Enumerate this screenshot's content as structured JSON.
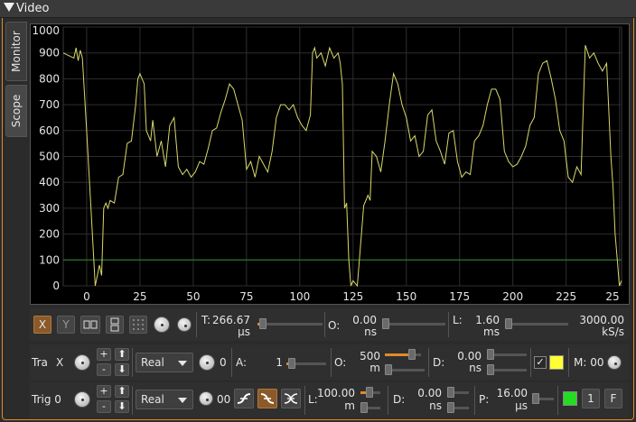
{
  "window": {
    "title": "Video"
  },
  "side_tabs": {
    "monitor": "Monitor",
    "scope": "Scope"
  },
  "chart_data": {
    "type": "line",
    "xlim": [
      -11,
      251
    ],
    "ylim": [
      0,
      1000
    ],
    "x_ticks": [
      "0",
      "25",
      "50",
      "75",
      "100",
      "125",
      "150",
      "175",
      "200",
      "225",
      "25"
    ],
    "y_ticks": [
      "1000",
      "900",
      "800",
      "700",
      "600",
      "500",
      "400",
      "300",
      "200",
      "100",
      "0"
    ],
    "trigger_level": 100,
    "grid": true,
    "series": [
      {
        "color": "#d8d86a",
        "x": [
          -11,
          -6,
          -5,
          -4,
          -3,
          -2,
          0,
          2,
          4,
          6,
          7,
          8,
          9,
          10,
          11,
          13,
          15,
          17,
          19,
          21,
          23,
          24,
          25,
          27,
          28,
          30,
          31,
          33,
          35,
          37,
          39,
          41,
          43,
          45,
          47,
          49,
          51,
          53,
          55,
          57,
          59,
          61,
          63,
          65,
          67,
          69,
          71,
          73,
          75,
          77,
          79,
          81,
          83,
          85,
          87,
          89,
          91,
          93,
          95,
          97,
          99,
          101,
          103,
          105,
          106,
          107,
          108,
          110,
          112,
          114,
          116,
          118,
          119,
          120,
          121,
          122,
          123,
          124,
          125,
          127,
          130,
          132,
          133,
          134,
          136,
          138,
          140,
          142,
          144,
          146,
          148,
          150,
          152,
          154,
          156,
          158,
          160,
          162,
          164,
          166,
          168,
          170,
          172,
          174,
          176,
          178,
          180,
          182,
          184,
          186,
          188,
          190,
          192,
          194,
          196,
          198,
          200,
          202,
          204,
          206,
          208,
          210,
          212,
          214,
          216,
          218,
          220,
          222,
          224,
          226,
          228,
          230,
          232,
          234,
          236,
          238,
          240,
          242,
          244,
          246,
          247,
          248,
          249,
          250,
          251
        ],
        "y": [
          900,
          880,
          920,
          870,
          910,
          880,
          600,
          300,
          0,
          80,
          40,
          300,
          320,
          300,
          330,
          320,
          420,
          430,
          550,
          560,
          700,
          800,
          820,
          780,
          600,
          560,
          640,
          500,
          560,
          460,
          620,
          650,
          460,
          430,
          450,
          420,
          440,
          480,
          470,
          530,
          600,
          610,
          670,
          720,
          780,
          760,
          700,
          640,
          450,
          480,
          420,
          500,
          470,
          440,
          520,
          650,
          700,
          700,
          680,
          700,
          650,
          620,
          600,
          660,
          900,
          920,
          880,
          900,
          850,
          920,
          880,
          900,
          860,
          780,
          300,
          320,
          100,
          0,
          20,
          0,
          310,
          350,
          330,
          520,
          500,
          440,
          560,
          700,
          820,
          780,
          700,
          650,
          560,
          580,
          500,
          520,
          660,
          680,
          560,
          520,
          470,
          590,
          600,
          480,
          420,
          440,
          430,
          560,
          580,
          620,
          700,
          760,
          760,
          720,
          520,
          480,
          460,
          470,
          500,
          540,
          620,
          650,
          820,
          860,
          870,
          800,
          720,
          600,
          560,
          420,
          400,
          460,
          430,
          930,
          880,
          900,
          860,
          830,
          860,
          500,
          380,
          200,
          100,
          0,
          20
        ]
      }
    ]
  },
  "controls": {
    "x_button": "X",
    "y_button": "Y",
    "time_label": "T:",
    "time_value": "266.67",
    "time_unit": "µs",
    "offset_label": "O:",
    "offset_value": "0.00",
    "offset_unit": "ns",
    "length_label": "L:",
    "length_value": "1.60",
    "length_unit": "ms",
    "rate_value": "3000.00",
    "rate_unit": "kS/s"
  },
  "trace": {
    "label": "Tra",
    "axis": "X",
    "plus": "+",
    "minus": "-",
    "mode": "Real",
    "knob_value": "0",
    "amp_label": "A:",
    "amp_value": "1",
    "ofs_label": "O:",
    "ofs_value": "500",
    "ofs_unit": "m",
    "delay_label": "D:",
    "delay_value": "0.00",
    "delay_unit": "ns",
    "check_mark": "✓",
    "memory": "M: 00",
    "color": "#ffff33"
  },
  "trigger": {
    "label": "Trig 0",
    "plus": "+",
    "minus": "-",
    "mode": "Real",
    "knob_value": "00",
    "level_label": "L:",
    "level_value": "100.00",
    "level_unit": "m",
    "delay_label": "D:",
    "delay_value": "0.00",
    "delay_unit": "ns",
    "pre_label": "P:",
    "pre_value": "16.00",
    "pre_unit": "µs",
    "one_button": "1",
    "free_button": "F",
    "color": "#22dd22"
  }
}
